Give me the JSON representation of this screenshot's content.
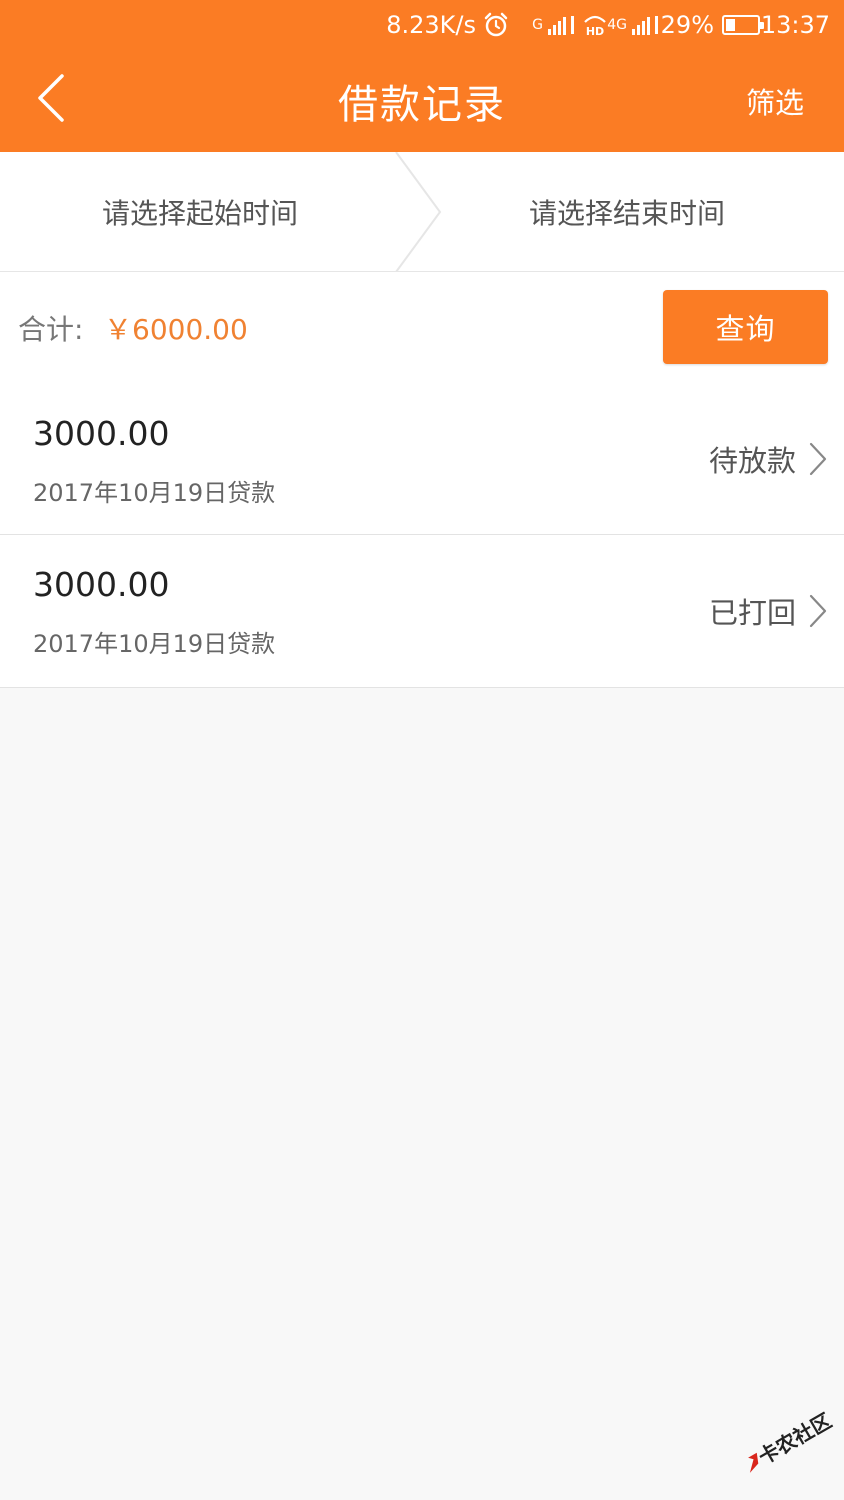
{
  "status_bar": {
    "net_speed": "8.23K/s",
    "sim1_tag": "G",
    "hd_tag": "HD",
    "sim2_tag": "4G",
    "battery_percent": "29%",
    "battery_level": 0.29,
    "time": "13:37"
  },
  "nav": {
    "title": "借款记录",
    "filter_label": "筛选"
  },
  "date_range": {
    "start_placeholder": "请选择起始时间",
    "end_placeholder": "请选择结束时间"
  },
  "summary": {
    "total_label": "合计:",
    "total_value": "￥6000.00",
    "query_label": "查询"
  },
  "records": [
    {
      "amount": "3000.00",
      "date": "2017年10月19日贷款",
      "status": "待放款"
    },
    {
      "amount": "3000.00",
      "date": "2017年10月19日贷款",
      "status": "已打回"
    }
  ],
  "watermark": {
    "text": "卡农社区"
  },
  "colors": {
    "accent": "#fb7c24",
    "total_value": "#f08232",
    "background": "#f8f8f8"
  }
}
